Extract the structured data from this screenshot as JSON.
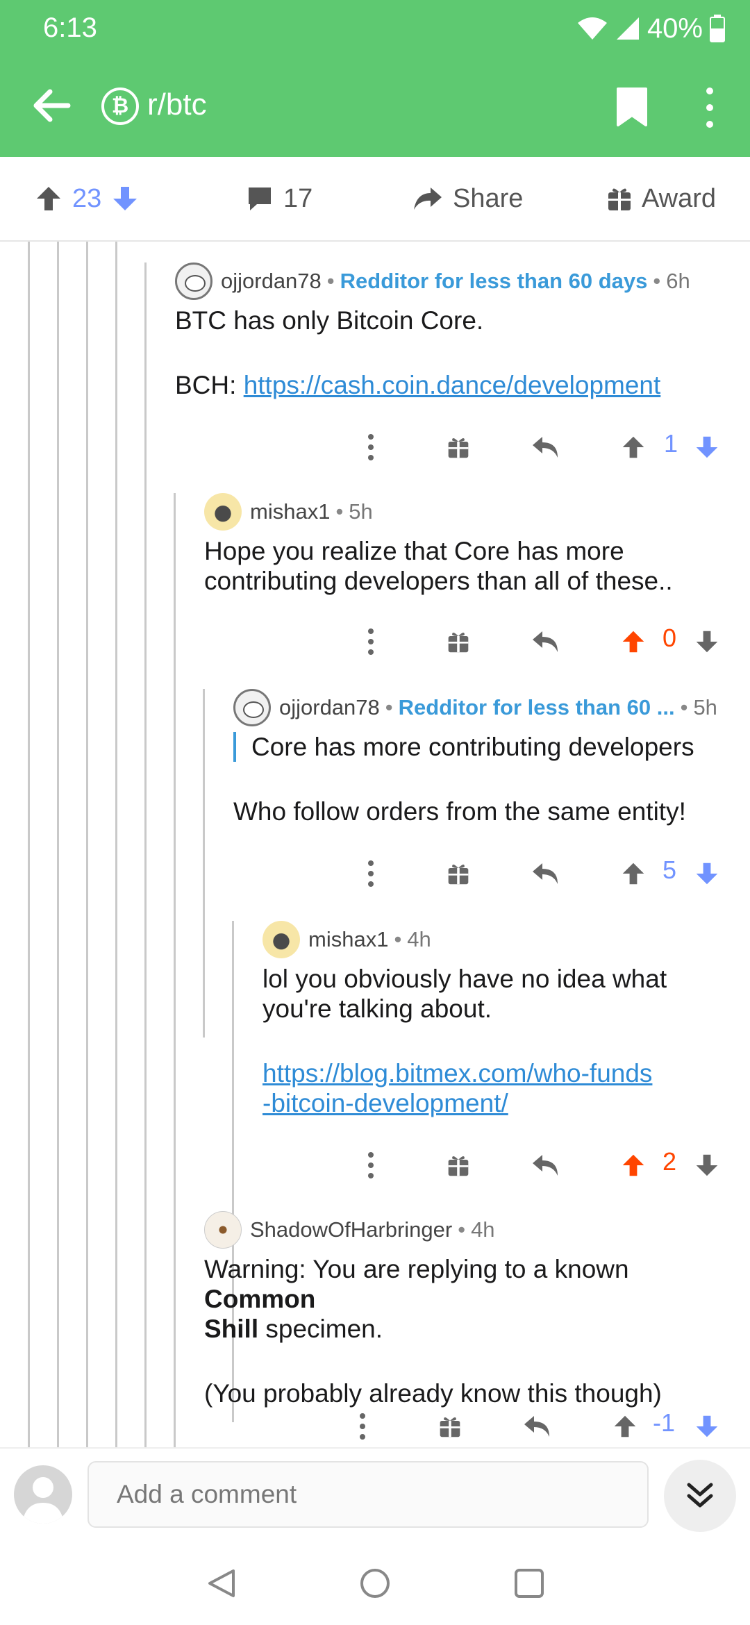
{
  "status_bar": {
    "time": "6:13",
    "battery": "40%"
  },
  "app_bar": {
    "subreddit": "r/btc",
    "subreddit_icon": "bitcoin-icon"
  },
  "post_actions": {
    "upvotes": "23",
    "comments": "17",
    "share_label": "Share",
    "award_label": "Award"
  },
  "comments": [
    {
      "username": "ojjordan78",
      "flair": "Redditor for less than 60 days",
      "age": "6h",
      "lines": [
        "BTC has only Bitcoin Core."
      ],
      "link_prefix": "BCH: ",
      "link": "https://cash.coin.dance/development",
      "score": "1"
    },
    {
      "username": "mishax1",
      "age": "5h",
      "lines": [
        "Hope you realize that Core has more",
        "contributing developers than all of these.."
      ],
      "score": "0"
    },
    {
      "username": "ojjordan78",
      "flair": "Redditor for less than 60 ...",
      "age": "5h",
      "quote": "Core has more contributing developers",
      "lines": [
        "Who follow orders from the same entity!"
      ],
      "score": "5"
    },
    {
      "username": "mishax1",
      "age": "4h",
      "lines": [
        "lol you obviously have no idea what",
        "you're talking about."
      ],
      "link_lines": [
        "https://blog.bitmex.com/who-funds",
        "-bitcoin-development/"
      ],
      "score": "2"
    },
    {
      "username": "ShadowOfHarbringer",
      "age": "4h",
      "line1_pre": "Warning: You are replying to a known ",
      "line1_bold": "Common",
      "line2_bold": "Shill",
      "line2_post": " specimen.",
      "line3": "(You probably already know this though)",
      "score": "-1"
    }
  ],
  "composer": {
    "placeholder": "Add a comment"
  },
  "colors": {
    "header": "#5ec971",
    "upvoted": "#ff4500",
    "downvote": "#7193ff",
    "flair": "#3a9ad9"
  }
}
